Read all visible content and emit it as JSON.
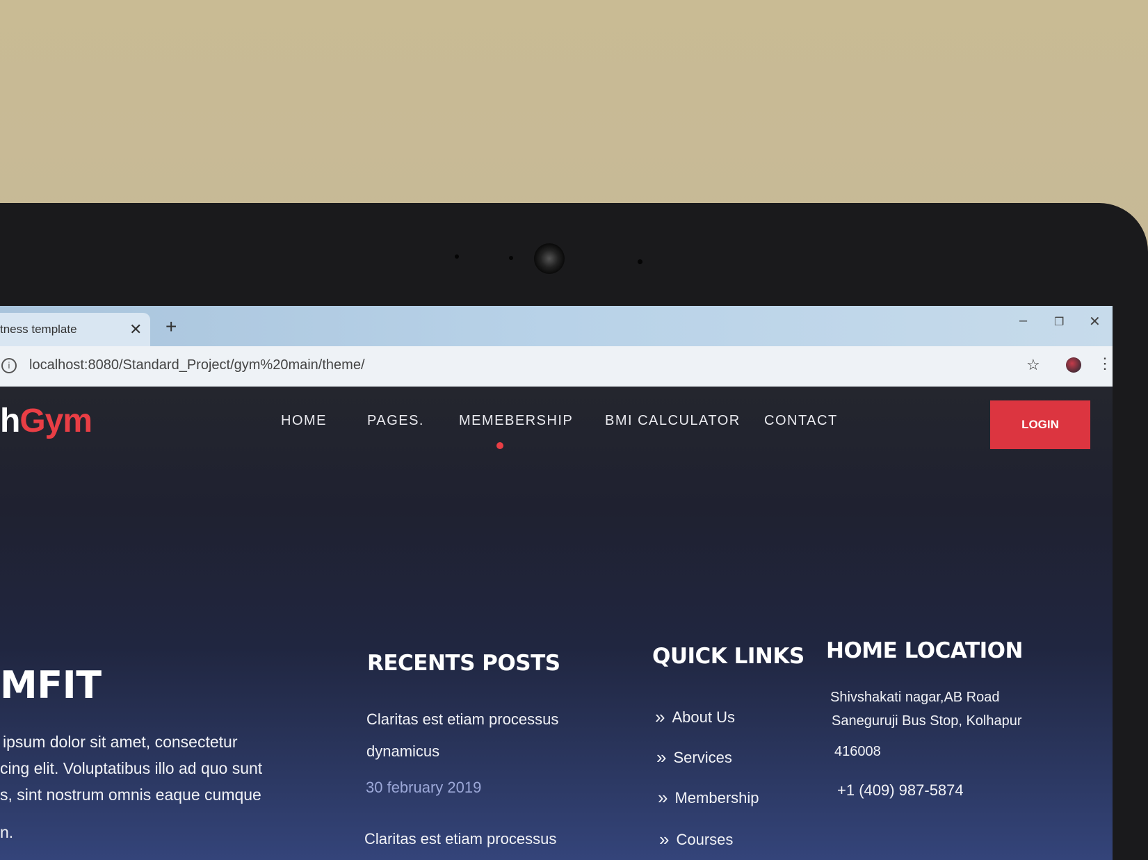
{
  "browser": {
    "tab_title": "tness template",
    "tab_close": "✕",
    "new_tab": "+",
    "address": "localhost:8080/Standard_Project/gym%20main/theme/",
    "info_icon": "i",
    "star_icon": "☆",
    "menu_icon": "⋮",
    "minimize_icon": "–",
    "restore_icon": "❐",
    "close_icon": "✕"
  },
  "site": {
    "logo_prefix": "h",
    "logo_main": "Gym",
    "nav": [
      "HOME",
      "PAGES.",
      "MEMEBERSHIP",
      "BMI CALCULATOR",
      "CONTACT"
    ],
    "login_label": "LOGIN",
    "colors": {
      "accent": "#e93e45",
      "nav_text": "#e9e9ee",
      "bg_dark": "#1f2130"
    }
  },
  "footer": {
    "brand": "MFIT",
    "about_lines": [
      "ipsum dolor sit amet, consectetur",
      "cing elit. Voluptatibus illo ad quo sunt",
      "s, sint nostrum omnis eaque cumque",
      "n."
    ],
    "recent_posts": {
      "heading": "RECENTS POSTS",
      "post1_line1": "Claritas est etiam processus",
      "post1_line2": "dynamicus",
      "post1_date": "30 february 2019",
      "post2_line1": "Claritas est etiam processus"
    },
    "quick_links": {
      "heading": "QUICK LINKS",
      "chevron": "»",
      "items": [
        "About Us",
        "Services",
        "Membership",
        "Courses"
      ]
    },
    "home_location": {
      "heading": "HOME LOCATION",
      "line1": "Shivshakati nagar,AB Road",
      "line2": "Saneguruji Bus Stop, Kolhapur",
      "line3": "416008",
      "phone": "+1 (409) 987-5874"
    }
  }
}
